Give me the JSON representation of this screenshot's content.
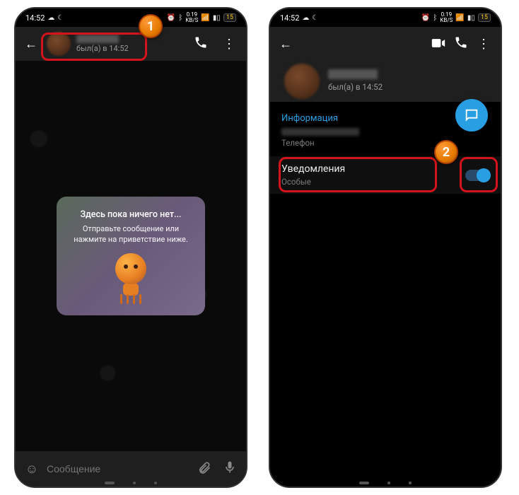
{
  "status": {
    "time": "14:52",
    "net_speed": "0.19",
    "net_unit": "KB/S",
    "battery": "15"
  },
  "chat": {
    "last_seen": "был(а) в 14:52",
    "empty_title": "Здесь пока ничего нет...",
    "empty_subtitle": "Отправьте сообщение или нажмите на приветствие ниже.",
    "input_placeholder": "Сообщение"
  },
  "profile": {
    "last_seen": "был(а) в 14:52",
    "info_label": "Информация",
    "phone_label": "Телефон",
    "notif_title": "Уведомления",
    "notif_sub": "Особые",
    "toggle_on": true
  },
  "callouts": {
    "badge1": "1",
    "badge2": "2"
  }
}
